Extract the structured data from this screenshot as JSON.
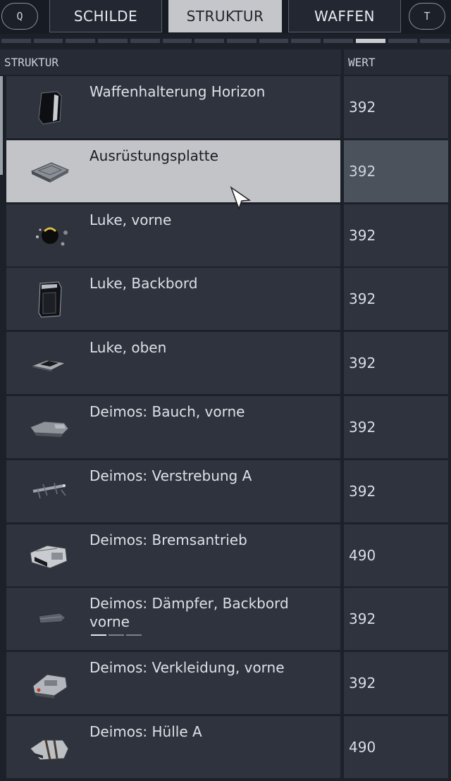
{
  "topbar": {
    "left_key": "Q",
    "right_key": "T",
    "tabs": [
      {
        "label": "SCHILDE",
        "active": false
      },
      {
        "label": "STRUKTUR",
        "active": true
      },
      {
        "label": "WAFFEN",
        "active": false
      }
    ],
    "subtab_count": 14,
    "active_subtab_index": 11
  },
  "table": {
    "columns": [
      "STRUKTUR",
      "WERT"
    ],
    "rows": [
      {
        "name": "Waffenhalterung Horizon",
        "value": "392",
        "icon": "weapon-mount-icon"
      },
      {
        "name": "Ausrüstungsplatte",
        "value": "392",
        "icon": "equipment-plate-icon",
        "selected": true
      },
      {
        "name": "Luke, vorne",
        "value": "392",
        "icon": "hatch-front-icon"
      },
      {
        "name": "Luke, Backbord",
        "value": "392",
        "icon": "hatch-port-icon"
      },
      {
        "name": "Luke, oben",
        "value": "392",
        "icon": "hatch-top-icon"
      },
      {
        "name": "Deimos: Bauch, vorne",
        "value": "392",
        "icon": "belly-front-icon"
      },
      {
        "name": "Deimos: Verstrebung A",
        "value": "392",
        "icon": "strut-icon"
      },
      {
        "name": "Deimos: Bremsantrieb",
        "value": "490",
        "icon": "retro-thruster-icon"
      },
      {
        "name": "Deimos: Dämpfer, Backbord vorne",
        "value": "392",
        "icon": "damper-icon",
        "carousel_dashes": 3,
        "carousel_active": 0
      },
      {
        "name": "Deimos: Verkleidung, vorne",
        "value": "392",
        "icon": "cowling-front-icon"
      },
      {
        "name": "Deimos: Hülle A",
        "value": "490",
        "icon": "hull-icon"
      }
    ]
  },
  "colors": {
    "background": "#1c2029",
    "cell": "#2e333e",
    "selected_cell": "#c2c4c7",
    "active_tab": "#c4c6c9"
  }
}
